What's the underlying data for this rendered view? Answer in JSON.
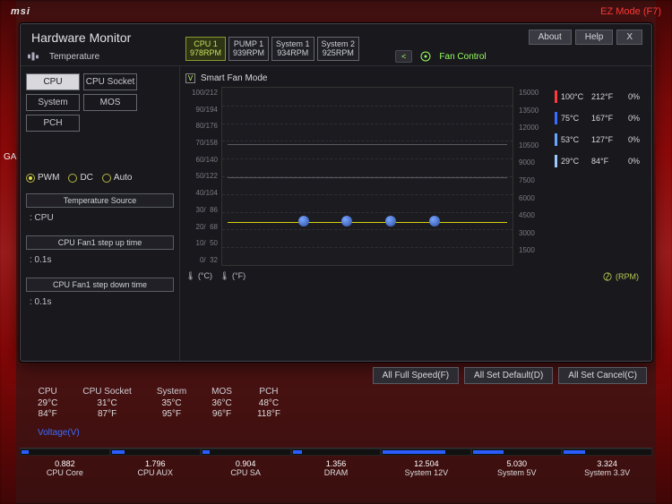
{
  "top_bar": {
    "brand": "msi",
    "ez_mode": "EZ Mode (F7)"
  },
  "dialog": {
    "title": "Hardware Monitor",
    "buttons": {
      "about": "About",
      "help": "Help",
      "close": "X"
    }
  },
  "sections": {
    "temperature": "Temperature",
    "fan_control": "Fan Control"
  },
  "temp_tabs": {
    "cpu": "CPU",
    "cpu_socket": "CPU Socket",
    "system": "System",
    "mos": "MOS",
    "pch": "PCH"
  },
  "fan_tabs": [
    {
      "top": "CPU 1",
      "bottom": "978RPM",
      "active": true
    },
    {
      "top": "PUMP 1",
      "bottom": "939RPM",
      "active": false
    },
    {
      "top": "System 1",
      "bottom": "934RPM",
      "active": false
    },
    {
      "top": "System 2",
      "bottom": "925RPM",
      "active": false
    }
  ],
  "fan_mode": {
    "pwm": "PWM",
    "dc": "DC",
    "auto": "Auto",
    "selected": "pwm"
  },
  "config": {
    "temp_source_label": "Temperature Source",
    "temp_source_value": ": CPU",
    "step_up_label": "CPU Fan1 step up time",
    "step_up_value": ": 0.1s",
    "step_down_label": "CPU Fan1 step down time",
    "step_down_value": ": 0.1s"
  },
  "smart_fan": {
    "label": "Smart Fan Mode",
    "checked": true
  },
  "chart_data": {
    "type": "line",
    "y_labels": [
      "100/212",
      "90/194",
      "80/176",
      "70/158",
      "60/140",
      "50/122",
      "40/104",
      "30/  86",
      "20/  68",
      "10/  50",
      "0/  32"
    ],
    "rpm_labels": [
      "15000",
      "13500",
      "12000",
      "10500",
      "9000",
      "7500",
      "6000",
      "4500",
      "3000",
      "1500",
      ""
    ],
    "points_pct": [
      28,
      43,
      58,
      73
    ],
    "xlabel_c": "(°C)",
    "xlabel_f": "(°F)",
    "rpm_label": "(RPM)"
  },
  "legend": [
    {
      "color": "#ff3a3a",
      "c": "100°C",
      "f": "212°F",
      "p": "0%"
    },
    {
      "color": "#3b6cff",
      "c": "75°C",
      "f": "167°F",
      "p": "0%"
    },
    {
      "color": "#6aa6ff",
      "c": "53°C",
      "f": "127°F",
      "p": "0%"
    },
    {
      "color": "#9cc8ff",
      "c": "29°C",
      "f": "84°F",
      "p": "0%"
    }
  ],
  "actions": {
    "full_speed": "All Full Speed(F)",
    "set_default": "All Set Default(D)",
    "set_cancel": "All Set Cancel(C)"
  },
  "temp_strip": [
    {
      "name": "CPU",
      "c": "29°C",
      "f": "84°F"
    },
    {
      "name": "CPU Socket",
      "c": "31°C",
      "f": "87°F"
    },
    {
      "name": "System",
      "c": "35°C",
      "f": "95°F"
    },
    {
      "name": "MOS",
      "c": "36°C",
      "f": "96°F"
    },
    {
      "name": "PCH",
      "c": "48°C",
      "f": "118°F"
    }
  ],
  "voltage_label": "Voltage(V)",
  "volt_strip": [
    {
      "name": "CPU Core",
      "val": "0.882",
      "fill": 8
    },
    {
      "name": "CPU AUX",
      "val": "1.796",
      "fill": 14
    },
    {
      "name": "CPU SA",
      "val": "0.904",
      "fill": 8
    },
    {
      "name": "DRAM",
      "val": "1.356",
      "fill": 11
    },
    {
      "name": "System 12V",
      "val": "12.504",
      "fill": 70
    },
    {
      "name": "System 5V",
      "val": "5.030",
      "fill": 34
    },
    {
      "name": "System 3.3V",
      "val": "3.324",
      "fill": 24
    }
  ],
  "edge_label": "GA"
}
